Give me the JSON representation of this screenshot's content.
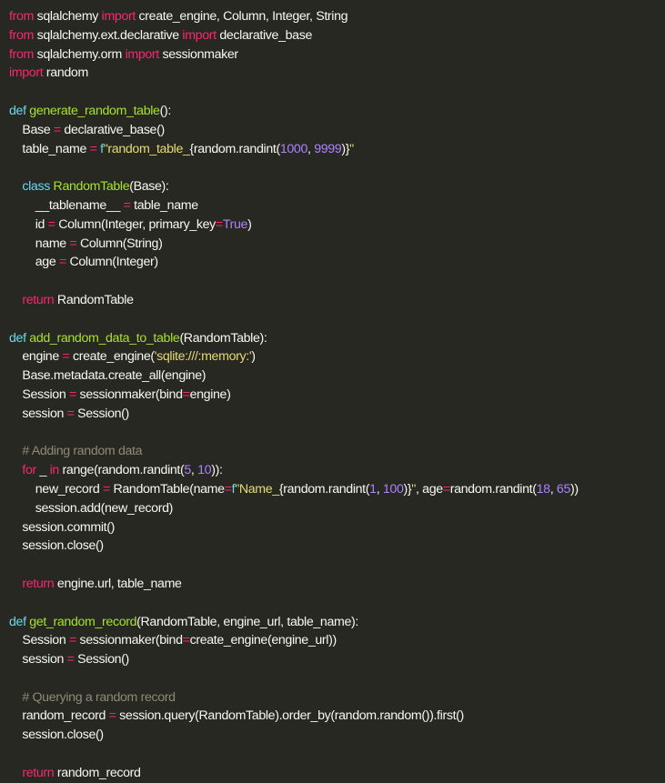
{
  "editor": {
    "colors": {
      "background": "#272822",
      "default": "#f8f8f2",
      "keyword": "#f92672",
      "operator": "#f92672",
      "func": "#a6e22e",
      "class": "#a6e22e",
      "builtin": "#66d9ef",
      "number": "#ae81ff",
      "const": "#ae81ff",
      "string": "#e6db74",
      "param": "#fd971f",
      "comment": "#8f8a74"
    },
    "lines": [
      [
        [
          "keyword",
          "from"
        ],
        [
          "default",
          " sqlalchemy "
        ],
        [
          "keyword",
          "import"
        ],
        [
          "default",
          " create_engine, Column, Integer, String"
        ]
      ],
      [
        [
          "keyword",
          "from"
        ],
        [
          "default",
          " sqlalchemy.ext.declarative "
        ],
        [
          "keyword",
          "import"
        ],
        [
          "default",
          " declarative_base"
        ]
      ],
      [
        [
          "keyword",
          "from"
        ],
        [
          "default",
          " sqlalchemy.orm "
        ],
        [
          "keyword",
          "import"
        ],
        [
          "default",
          " sessionmaker"
        ]
      ],
      [
        [
          "keyword",
          "import"
        ],
        [
          "default",
          " random"
        ]
      ],
      [],
      [
        [
          "builtin",
          "def"
        ],
        [
          "default",
          " "
        ],
        [
          "func",
          "generate_random_table"
        ],
        [
          "default",
          "():"
        ]
      ],
      [
        [
          "default",
          "    Base "
        ],
        [
          "operator",
          "="
        ],
        [
          "default",
          " declarative_base()"
        ]
      ],
      [
        [
          "default",
          "    table_name "
        ],
        [
          "operator",
          "="
        ],
        [
          "default",
          " "
        ],
        [
          "builtin",
          "f"
        ],
        [
          "string",
          "\"random_table_"
        ],
        [
          "default",
          "{random.randint("
        ],
        [
          "number",
          "1000"
        ],
        [
          "default",
          ", "
        ],
        [
          "number",
          "9999"
        ],
        [
          "default",
          ")}"
        ],
        [
          "string",
          "\""
        ]
      ],
      [],
      [
        [
          "default",
          "    "
        ],
        [
          "builtin",
          "class"
        ],
        [
          "default",
          " "
        ],
        [
          "class",
          "RandomTable"
        ],
        [
          "default",
          "(Base):"
        ]
      ],
      [
        [
          "default",
          "        __tablename__ "
        ],
        [
          "operator",
          "="
        ],
        [
          "default",
          " table_name"
        ]
      ],
      [
        [
          "default",
          "        id "
        ],
        [
          "operator",
          "="
        ],
        [
          "default",
          " Column(Integer, primary_key"
        ],
        [
          "operator",
          "="
        ],
        [
          "const",
          "True"
        ],
        [
          "default",
          ")"
        ]
      ],
      [
        [
          "default",
          "        name "
        ],
        [
          "operator",
          "="
        ],
        [
          "default",
          " Column(String)"
        ]
      ],
      [
        [
          "default",
          "        age "
        ],
        [
          "operator",
          "="
        ],
        [
          "default",
          " Column(Integer)"
        ]
      ],
      [],
      [
        [
          "default",
          "    "
        ],
        [
          "keyword",
          "return"
        ],
        [
          "default",
          " RandomTable"
        ]
      ],
      [],
      [
        [
          "builtin",
          "def"
        ],
        [
          "default",
          " "
        ],
        [
          "func",
          "add_random_data_to_table"
        ],
        [
          "default",
          "(RandomTable):"
        ]
      ],
      [
        [
          "default",
          "    engine "
        ],
        [
          "operator",
          "="
        ],
        [
          "default",
          " create_engine("
        ],
        [
          "string",
          "'sqlite:///:memory:'"
        ],
        [
          "default",
          ")"
        ]
      ],
      [
        [
          "default",
          "    Base.metadata.create_all(engine)"
        ]
      ],
      [
        [
          "default",
          "    Session "
        ],
        [
          "operator",
          "="
        ],
        [
          "default",
          " sessionmaker(bind"
        ],
        [
          "operator",
          "="
        ],
        [
          "default",
          "engine)"
        ]
      ],
      [
        [
          "default",
          "    session "
        ],
        [
          "operator",
          "="
        ],
        [
          "default",
          " Session()"
        ]
      ],
      [],
      [
        [
          "comment",
          "    # Adding random data"
        ]
      ],
      [
        [
          "default",
          "    "
        ],
        [
          "keyword",
          "for"
        ],
        [
          "default",
          " _ "
        ],
        [
          "keyword",
          "in"
        ],
        [
          "default",
          " range(random.randint("
        ],
        [
          "number",
          "5"
        ],
        [
          "default",
          ", "
        ],
        [
          "number",
          "10"
        ],
        [
          "default",
          ")):"
        ]
      ],
      [
        [
          "default",
          "        new_record "
        ],
        [
          "operator",
          "="
        ],
        [
          "default",
          " RandomTable(name"
        ],
        [
          "operator",
          "="
        ],
        [
          "builtin",
          "f"
        ],
        [
          "string",
          "\"Name_"
        ],
        [
          "default",
          "{random.randint("
        ],
        [
          "number",
          "1"
        ],
        [
          "default",
          ", "
        ],
        [
          "number",
          "100"
        ],
        [
          "default",
          ")}"
        ],
        [
          "string",
          "\""
        ],
        [
          "default",
          ", age"
        ],
        [
          "operator",
          "="
        ],
        [
          "default",
          "random.randint("
        ],
        [
          "number",
          "18"
        ],
        [
          "default",
          ", "
        ],
        [
          "number",
          "65"
        ],
        [
          "default",
          "))"
        ]
      ],
      [
        [
          "default",
          "        session.add(new_record)"
        ]
      ],
      [
        [
          "default",
          "    session.commit()"
        ]
      ],
      [
        [
          "default",
          "    session.close()"
        ]
      ],
      [],
      [
        [
          "default",
          "    "
        ],
        [
          "keyword",
          "return"
        ],
        [
          "default",
          " engine.url, table_name"
        ]
      ],
      [],
      [
        [
          "builtin",
          "def"
        ],
        [
          "default",
          " "
        ],
        [
          "func",
          "get_random_record"
        ],
        [
          "default",
          "(RandomTable, engine_url, table_name):"
        ]
      ],
      [
        [
          "default",
          "    Session "
        ],
        [
          "operator",
          "="
        ],
        [
          "default",
          " sessionmaker(bind"
        ],
        [
          "operator",
          "="
        ],
        [
          "default",
          "create_engine(engine_url))"
        ]
      ],
      [
        [
          "default",
          "    session "
        ],
        [
          "operator",
          "="
        ],
        [
          "default",
          " Session()"
        ]
      ],
      [],
      [
        [
          "comment",
          "    # Querying a random record"
        ]
      ],
      [
        [
          "default",
          "    random_record "
        ],
        [
          "operator",
          "="
        ],
        [
          "default",
          " session.query(RandomTable).order_by(random.random()).first()"
        ]
      ],
      [
        [
          "default",
          "    session.close()"
        ]
      ],
      [],
      [
        [
          "default",
          "    "
        ],
        [
          "keyword",
          "return"
        ],
        [
          "default",
          " random_record"
        ]
      ]
    ]
  }
}
